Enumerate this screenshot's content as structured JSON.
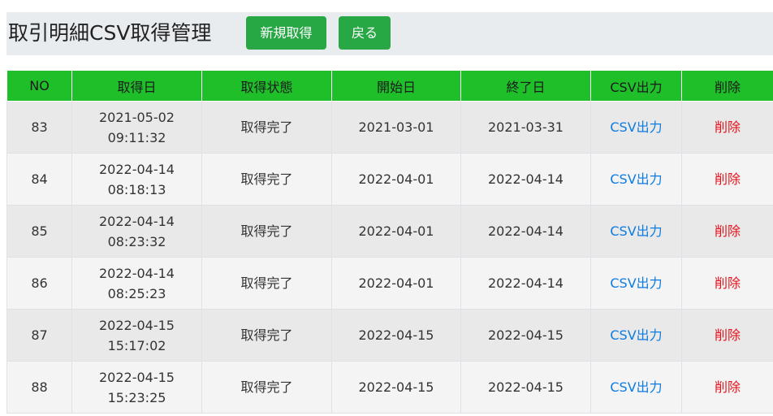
{
  "header": {
    "title": "取引明細CSV取得管理",
    "new_button": "新規取得",
    "back_button": "戻る"
  },
  "table": {
    "columns": [
      "NO",
      "取得日",
      "取得状態",
      "開始日",
      "終了日",
      "CSV出力",
      "削除"
    ],
    "rows": [
      {
        "no": "83",
        "date": "2021-05-02",
        "time": "09:11:32",
        "status": "取得完了",
        "start": "2021-03-01",
        "end": "2021-03-31",
        "csv": "CSV出力",
        "del": "削除"
      },
      {
        "no": "84",
        "date": "2022-04-14",
        "time": "08:18:13",
        "status": "取得完了",
        "start": "2022-04-01",
        "end": "2022-04-14",
        "csv": "CSV出力",
        "del": "削除"
      },
      {
        "no": "85",
        "date": "2022-04-14",
        "time": "08:23:32",
        "status": "取得完了",
        "start": "2022-04-01",
        "end": "2022-04-14",
        "csv": "CSV出力",
        "del": "削除"
      },
      {
        "no": "86",
        "date": "2022-04-14",
        "time": "08:25:23",
        "status": "取得完了",
        "start": "2022-04-01",
        "end": "2022-04-14",
        "csv": "CSV出力",
        "del": "削除"
      },
      {
        "no": "87",
        "date": "2022-04-15",
        "time": "15:17:02",
        "status": "取得完了",
        "start": "2022-04-15",
        "end": "2022-04-15",
        "csv": "CSV出力",
        "del": "削除"
      },
      {
        "no": "88",
        "date": "2022-04-15",
        "time": "15:23:25",
        "status": "取得完了",
        "start": "2022-04-15",
        "end": "2022-04-15",
        "csv": "CSV出力",
        "del": "削除"
      }
    ]
  },
  "colors": {
    "header_green": "#1fbf2a",
    "button_green": "#28a745",
    "link_blue": "#0d7be0",
    "delete_red": "#e3141e"
  }
}
